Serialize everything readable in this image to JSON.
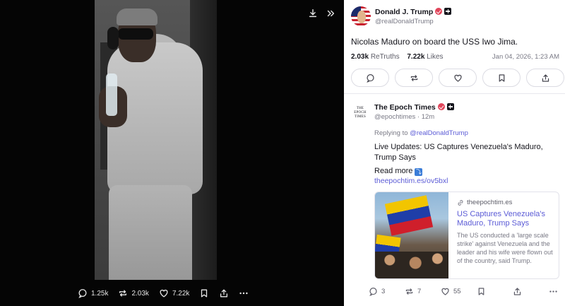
{
  "viewer": {
    "download_icon": "download-icon",
    "next_icon": "double-chevron-right-icon",
    "actions": {
      "reply_count": "1.25k",
      "retruth_count": "2.03k",
      "like_count": "7.22k"
    }
  },
  "post": {
    "author_name": "Donald J. Trump",
    "author_handle": "@realDonaldTrump",
    "text": "Nicolas Maduro on board the USS Iwo Jima.",
    "retruths_count": "2.03k",
    "retruths_label": "ReTruths",
    "likes_count": "7.22k",
    "likes_label": "Likes",
    "date": "Jan 04, 2026, 1:23 AM"
  },
  "reply": {
    "logo_text": "THE\nEPOCH\nTIMES",
    "author_name": "The Epoch Times",
    "author_handle": "@epochtimes",
    "time": "12m",
    "replying_to_label": "Replying to",
    "replying_to_handle": "@realDonaldTrump",
    "text": "Live Updates: US Captures Venezuela's Maduro, Trump Says",
    "read_more": "Read more",
    "read_more_emoji": "⤵",
    "link": "theepochtim.es/ov5bxl",
    "card": {
      "domain": "theepochtim.es",
      "title": "US Captures Venezuela's Maduro, Trump Says",
      "description": "The US conducted a 'large scale strike' against Venezuela and the leader and his wife were flown out of the country, said Trump."
    },
    "actions": {
      "reply_count": "3",
      "retruth_count": "7",
      "like_count": "55"
    }
  },
  "colors": {
    "accent": "#5b5bd6",
    "verified": "#e0455a",
    "viewer_bg": "#050505"
  }
}
